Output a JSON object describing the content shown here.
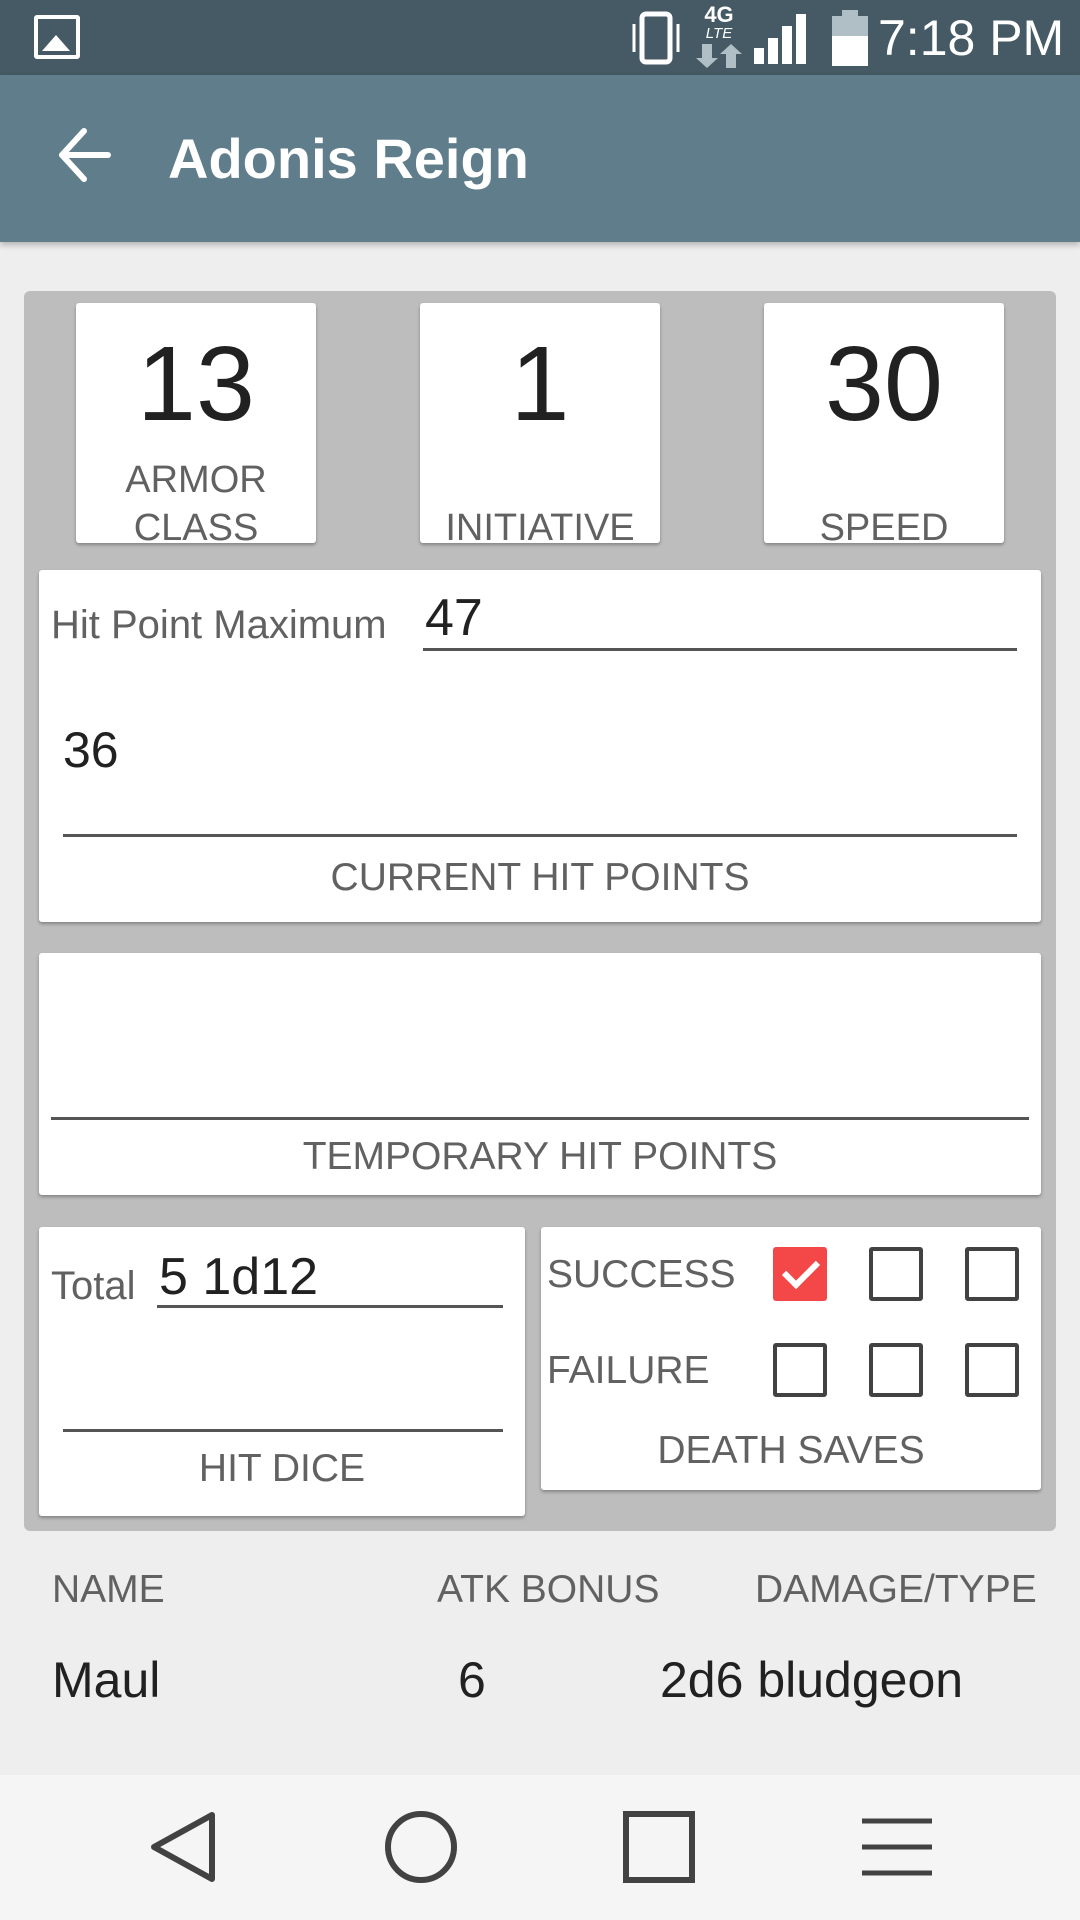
{
  "status_bar": {
    "time": "7:18 PM",
    "network": "4G LTE",
    "icons": [
      "gallery-icon",
      "vibrate-icon",
      "network-4g-lte-icon",
      "signal-icon",
      "battery-icon"
    ]
  },
  "app_bar": {
    "title": "Adonis Reign",
    "back_icon": "arrow-back-icon"
  },
  "stats": {
    "armor_class": {
      "value": "13",
      "label_line1": "ARMOR",
      "label_line2": "CLASS"
    },
    "initiative": {
      "value": "1",
      "label": "INITIATIVE"
    },
    "speed": {
      "value": "30",
      "label": "SPEED"
    }
  },
  "hit_points": {
    "max_label": "Hit Point Maximum",
    "max_value": "47",
    "current_value": "36",
    "current_caption": "CURRENT HIT POINTS"
  },
  "temp_hit_points": {
    "value": "",
    "caption": "TEMPORARY HIT POINTS"
  },
  "hit_dice": {
    "total_label": "Total",
    "total_value": "5 1d12",
    "value": "",
    "caption": "HIT DICE"
  },
  "death_saves": {
    "success_label": "SUCCESS",
    "failure_label": "FAILURE",
    "caption": "DEATH SAVES",
    "successes": [
      true,
      false,
      false
    ],
    "failures": [
      false,
      false,
      false
    ]
  },
  "attacks": {
    "headers": {
      "name": "NAME",
      "atk_bonus": "ATK BONUS",
      "damage_type": "DAMAGE/TYPE"
    },
    "rows": [
      {
        "name": "Maul",
        "atk_bonus": "6",
        "damage_type": "2d6 bludgeon"
      }
    ]
  },
  "nav_bar": {
    "icons": [
      "nav-back-icon",
      "nav-home-icon",
      "nav-recents-icon",
      "nav-menu-icon"
    ]
  },
  "colors": {
    "status_bar": "#455a64",
    "app_bar": "#607d8b",
    "panel": "#bdbdbd",
    "checkbox_checked": "#f44747"
  }
}
